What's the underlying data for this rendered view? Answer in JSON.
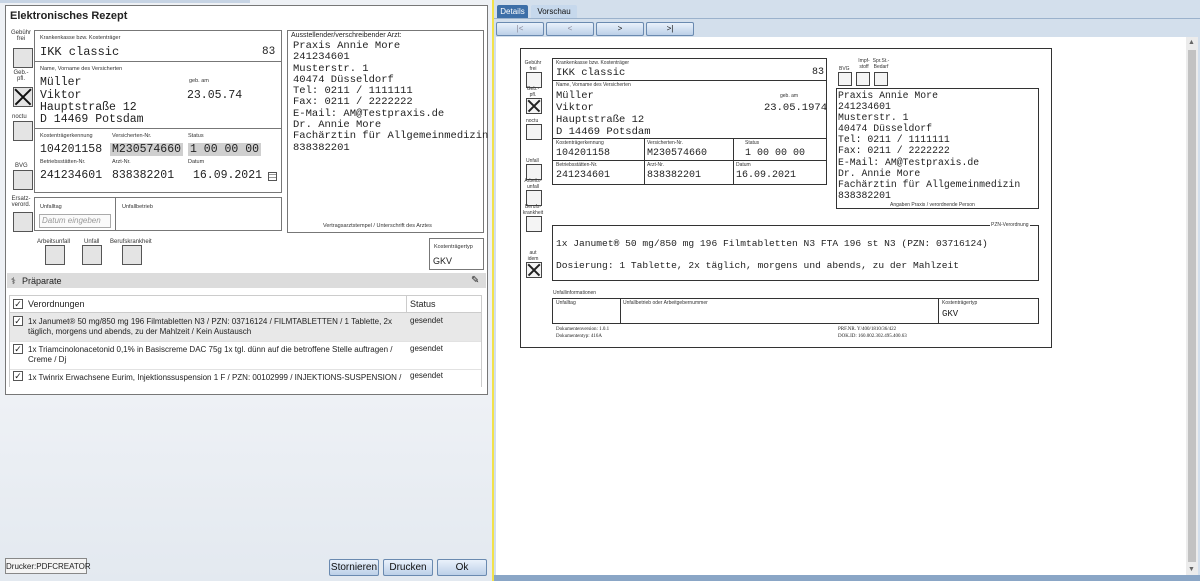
{
  "left": {
    "title": "Elektronisches Rezept",
    "gebuehr_frei": "Gebühr\nfrei",
    "geb_pfl": "Geb.-\npfl.",
    "noctu": "noctu",
    "bvg": "BVG",
    "ersatz": "Ersatz-\nverord.",
    "krankenkasse_label": "Krankenkasse bzw. Kostenträger",
    "krankenkasse": "IKK classic",
    "kk_number": "83",
    "name_label": "Name, Vorname des Versicherten",
    "geb_am_label": "geb. am",
    "lastname": "Müller",
    "firstname": "Viktor",
    "dob": "23.05.74",
    "street": "Hauptstraße 12",
    "city": "D 14469 Potsdam",
    "kt_kennung_label": "Kostenträgerkennung",
    "versicherten_nr_label": "Versicherten-Nr.",
    "status_label": "Status",
    "kt_kennung": "104201158",
    "versicherten_nr": "M230574660",
    "status": "1 00 00 00",
    "bsnr_label": "Betriebsstätten-Nr.",
    "arzt_nr_label": "Arzt-Nr.",
    "datum_label": "Datum",
    "bsnr": "241234601",
    "arzt_nr": "838382201",
    "datum": "16.09.2021",
    "unfalltag_label": "Unfalltag",
    "unfalltag_placeholder": "Datum eingeben",
    "unfallbetrieb_label": "Unfallbetrieb",
    "arzt_title": "Ausstellender/verschreibender Arzt:",
    "arzt_lines": [
      "Praxis Annie More",
      "241234601",
      "Musterstr. 1",
      "40474 Düsseldorf",
      "Tel: 0211 / 1111111",
      "Fax: 0211 / 2222222",
      "E-Mail: AM@Testpraxis.de",
      "Dr. Annie More",
      "Fachärztin für Allgemeinmedizin",
      "838382201"
    ],
    "stempel_label": "Vertragsarztstempel / Unterschrift des Arztes",
    "arbeitsunfall": "Arbeitsunfall",
    "unfall": "Unfall",
    "berufskrankheit": "Berufskrankheit",
    "kt_typ_label": "Kostenträgertyp",
    "kt_typ": "GKV",
    "praeparate_title": "Präparate",
    "table_col_verordnungen": "Verordnungen",
    "table_col_status": "Status",
    "rows": [
      {
        "text": "1x Janumet® 50 mg/850 mg 196 Filmtabletten N3 / PZN: 03716124 / FILMTABLETTEN / 1 Tablette, 2x täglich, morgens und abends, zu der Mahlzeit / Kein Austausch",
        "status": "gesendet"
      },
      {
        "text": "1x Triamcinolonacetonid 0,1% in Basiscreme DAC 75g 1x tgl. dünn auf die betroffene Stelle auftragen / Creme / Dj",
        "status": "gesendet"
      },
      {
        "text": "1x Twinrix Erwachsene Eurim, Injektionssuspension 1 F / PZN: 00102999 / INJEKTIONS-SUSPENSION / Dj",
        "status": "gesendet"
      }
    ],
    "printer": "Drucker:PDFCREATOR",
    "btn_stornieren": "Stornieren",
    "btn_drucken": "Drucken",
    "btn_ok": "Ok"
  },
  "right": {
    "tabs": [
      "Details",
      "Vorschau"
    ],
    "nav_buttons": [
      "|<",
      "<",
      ">",
      ">|"
    ],
    "gebuehr_frei": "Gebühr\nfrei",
    "geb_pfl": "Geb.-\npfl.",
    "noctu": "noctu",
    "unfall": "Unfall",
    "arbeitsunfall": "Arbeits-\nunfall",
    "berufskrankheit": "Berufs-\nkrankheit",
    "aut_idem": "aut\nidem",
    "bvg": "BVG",
    "impf": "Impf-\nstoff",
    "spr": "Spr.St.-\nBedarf",
    "krankenkasse_label": "Krankenkasse bzw. Kostenträger",
    "krankenkasse": "IKK classic",
    "kk_number": "83",
    "name_label": "Name, Vorname des Versicherten",
    "geb_am_label": "geb. am",
    "lastname": "Müller",
    "firstname": "Viktor",
    "dob": "23.05.1974",
    "street": "Hauptstraße 12",
    "city": "D 14469 Potsdam",
    "kt_kennung_label": "Kostenträgerkennung",
    "versicherten_nr_label": "Versicherten-Nr.",
    "status_label": "Status",
    "kt_kennung": "104201158",
    "versicherten_nr": "M230574660",
    "status": "1 00 00 00",
    "bsnr_label": "Betriebsstätten-Nr.",
    "arzt_nr_label": "Arzt-Nr.",
    "datum_label": "Datum",
    "bsnr": "241234601",
    "arzt_nr": "838382201",
    "datum": "16.09.2021",
    "arzt_lines": [
      "Praxis Annie More",
      "241234601",
      "Musterstr.  1",
      "40474 Düsseldorf",
      "Tel: 0211 / 1111111",
      "Fax: 0211 / 2222222",
      "E-Mail: AM@Testpraxis.de",
      "Dr. Annie More",
      "Fachärztin für Allgemeinmedizin",
      "838382201"
    ],
    "angaben_label": "Angaben Praxis / verordnende Person",
    "pzn_label": "PZN-Verordnung",
    "med_line1": "1x Janumet® 50 mg/850 mg 196 Filmtabletten N3 FTA 196 st N3 (PZN: 03716124)",
    "med_line2": "Dosierung: 1 Tablette, 2x täglich, morgens und abends, zu der Mahlzeit",
    "unfallinfo_label": "Unfallinformationen",
    "unfalltag_label": "Unfalltag",
    "unfallbetrieb_label": "Unfallbetrieb oder Arbeitgebernummer",
    "kt_typ_label": "Kostenträgertyp",
    "kt_typ": "GKV",
    "doc_version": "Dokumentenversion:  1.0.1",
    "doc_type": "Dokumententyp:  416A",
    "prf": "PRF.NR.   Y/400/1810/36/422",
    "doc_id": "DOK.ID:   160.002.302.495.400.63"
  }
}
